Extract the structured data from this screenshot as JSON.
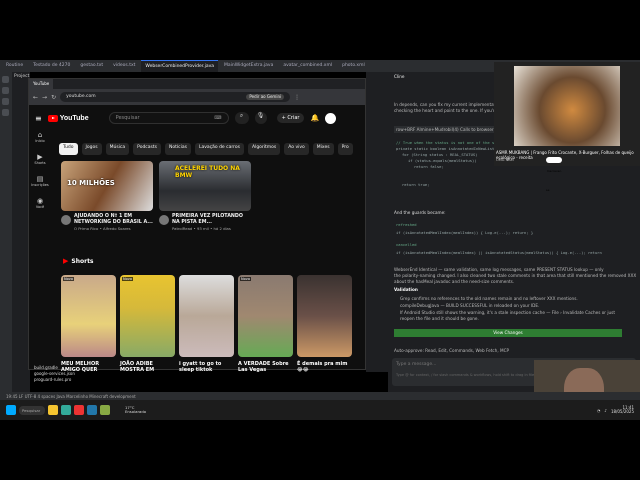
{
  "ide": {
    "tabs": [
      "Routine",
      "Testado de 4270",
      "gestao.txt",
      "videos.txt",
      "WebserCombinedProvider.java",
      "MainWidgetExtra.java",
      "avatar_combined.xml",
      "photo.xml"
    ],
    "project_label": "Project",
    "chat_title": "Cline",
    "status_text": "19:45  LF  UTF-8  4 spaces  Java  Marcelinho Minecraft development"
  },
  "browser": {
    "tabs": [
      "YouTube",
      "x",
      "",
      "",
      ""
    ],
    "url": "youtube.com",
    "gemini": "Pedir ao Gemini",
    "all_favorites": "Todos os marcadores"
  },
  "yt": {
    "search_placeholder": "Pesquisar",
    "create": "Criar",
    "sidebar": [
      {
        "icon": "⌂",
        "label": "Início"
      },
      {
        "icon": "▶",
        "label": "Shorts"
      },
      {
        "icon": "▤",
        "label": "Inscrições"
      },
      {
        "icon": "◉",
        "label": "Você"
      }
    ],
    "chips": [
      "Tudo",
      "Jogos",
      "Música",
      "Podcasts",
      "Notícias",
      "Lavação de carros",
      "Algoritmos",
      "Ao vivo",
      "Mixes",
      "Pro"
    ],
    "videos": [
      {
        "title": "AJUDANDO O Nº 1 EM NETWORKING DO BRASIL A...",
        "channel": "O Primo Rico",
        "views": "",
        "time": "",
        "meta2": "Alfredo Soares",
        "duration": "",
        "thumb_text": "10 MILHÕES"
      },
      {
        "title": "PRIMEIRA VEZ PILOTANDO NA PISTA EM...",
        "channel": "PatrolRead",
        "views": "93 mil",
        "time": "há 2 dias",
        "meta2": "",
        "duration": "",
        "thumb_text": "ACELEREI TUDO NA BMW"
      }
    ],
    "shorts_title": "Shorts",
    "shorts": [
      {
        "title": "MEU MELHOR AMIGO QUER",
        "badge": "Novo"
      },
      {
        "title": "JOÃO ADIBE MOSTRA EM",
        "badge": "Novo"
      },
      {
        "title": "i gyatt to go to sleep tiktok",
        "badge": ""
      },
      {
        "title": "A VERDADE Sobre Las Vegas",
        "badge": "Novo"
      },
      {
        "title": "É demais pra mim 😂😂",
        "badge": ""
      }
    ]
  },
  "chat": {
    "l1": "In depends, can you fix my current implementations? You're",
    "l2": "checking the heart and point to the one. If you're going",
    "l3": "row+BRF Almine+Mudrobil(4) Calls to browser method(4)",
    "comment": "// True when the status is not one of the status types",
    "c1": "private static boolean isAnnotatedInNewListing(String mealIndex) {",
    "c2": "for (String status : REAL_STATUS)",
    "c3": "if (status.equals(mealStatus))",
    "c4": "return false;",
    "c5": "return true;",
    "guard": "And the guards became:",
    "g1": "refreshed",
    "g2": "if (isAnnotatedMealIndex(mealIndex)) { Log.e(...); return; }",
    "g3": "cancelled",
    "g4": "if (isAnnotatedMealIndex(mealIndex) || isAnnotatedStatus(mealStatus)) { Log.e(...); return",
    "p1": "WebserEnd Identical — same validation, same log messages, same PRESENT STATUS lookup — only",
    "p2": "the polarity-naming changed. I also cleaned two stale comments in that area that still mentioned the removed XXX",
    "p3": "about the hasMeal javadoc and the need-size comments.",
    "val": "Validation",
    "b1": "Grep confirms no references to the old names remain and no leftover XXX mentions.",
    "b2": "compileDebugJava — BUILD SUCCESSFUL in reloaded on your IDE.",
    "b3": "If Android Studio still shows the warning, it's a stale inspection cache — File › Invalidate Caches or just",
    "b4": "reopen the file and it should be gone.",
    "apply": "View Changes",
    "auto": "Auto-approve: Read, Edit, Commands, Web Fetch, MCP",
    "input_placeholder": "Type a message...",
    "input_hint": "Type @ for context, / for slash commands & workflows, hold shift to drag in files/images"
  },
  "pip": {
    "title": "ASMR MUKBANG | Frango Frito Crocante, X-Burguer, Folhas de queijo ecológico - receita",
    "channel": "OMG NAM",
    "subscribe": "Inscrever-se"
  },
  "files": [
    "build.gradle",
    "google-services.json",
    "proguard-rules.pro"
  ],
  "taskbar": {
    "search": "Pesquisar",
    "weather_temp": "17°C",
    "weather_text": "Ensolarado",
    "time": "11:41",
    "date": "18/05/2025"
  }
}
